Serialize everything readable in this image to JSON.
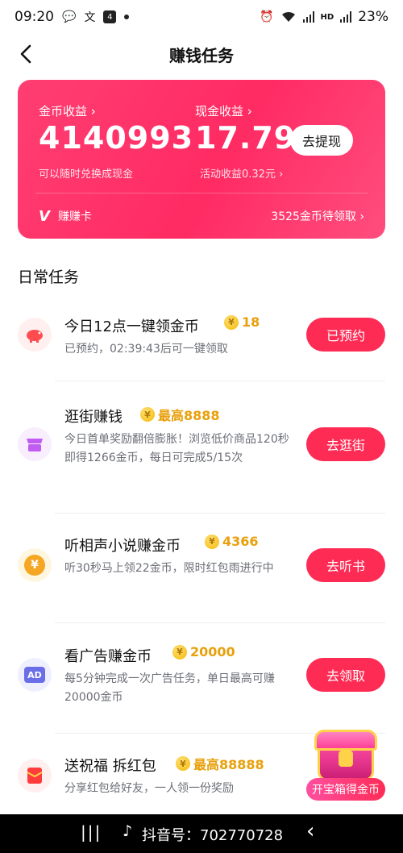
{
  "status_bar": {
    "time": "09:20",
    "battery": "23%",
    "icons": [
      "message-icon",
      "text-icon",
      "app-icon",
      "dot-icon",
      "alarm-icon",
      "clock-icon",
      "wifi-icon",
      "signal-icon",
      "hd-icon",
      "signal-5g-icon",
      "battery-icon"
    ]
  },
  "nav": {
    "title": "赚钱任务"
  },
  "card": {
    "coin_label": "金币收益",
    "coin_value": "4140993",
    "coin_sub": "可以随时兑换成现金",
    "cash_label": "现金收益",
    "cash_value": "17.79",
    "cash_sub": "活动收益0.32元",
    "withdraw": "去提现",
    "footer_left": "赚赚卡",
    "footer_right": "3525金币待领取"
  },
  "section_title": "日常任务",
  "tasks": [
    {
      "name": "今日12点一键领金币",
      "reward": "18",
      "desc": "已预约，02:39:43后可一键领取",
      "button": "已预约",
      "icon": "piggy-bank-icon"
    },
    {
      "name": "逛街赚钱",
      "reward": "最高8888",
      "desc": "今日首单奖励翻倍膨胀！浏览低价商品120秒即得1266金币，每日可完成5/15次",
      "button": "去逛街",
      "icon": "store-icon"
    },
    {
      "name": "听相声小说赚金币",
      "reward": "4366",
      "desc": "听30秒马上领22金币，限时红包雨进行中",
      "button": "去听书",
      "icon": "yuan-coin-icon"
    },
    {
      "name": "看广告赚金币",
      "reward": "20000",
      "desc": "每5分钟完成一次广告任务，单日最高可赚20000金币",
      "button": "去领取",
      "icon": "ad-icon"
    },
    {
      "name": "送祝福 拆红包",
      "reward": "最高88888",
      "desc": "分享红包给好友，一人领一份奖励",
      "button": "",
      "icon": "red-envelope-icon"
    }
  ],
  "ad_icon_text": "AD",
  "chest": {
    "label": "开宝箱得金币"
  },
  "bottom": {
    "text": "抖音号：702770728"
  },
  "colors": {
    "accent": "#fe2c55",
    "reward": "#e8a00b"
  }
}
